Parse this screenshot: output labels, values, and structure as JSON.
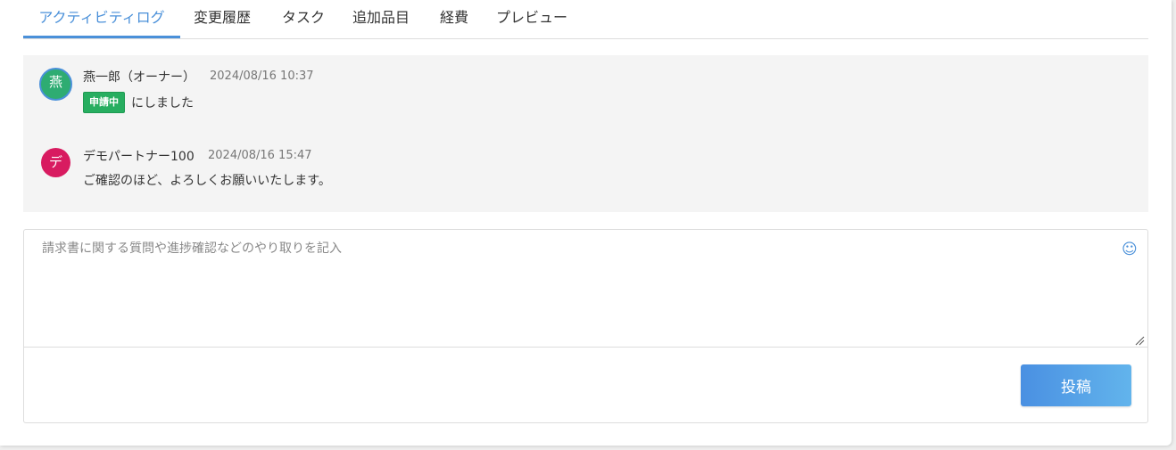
{
  "tabs": [
    {
      "label": "アクティビティログ",
      "active": true
    },
    {
      "label": "変更履歴",
      "active": false
    },
    {
      "label": "タスク",
      "active": false
    },
    {
      "label": "追加品目",
      "active": false
    },
    {
      "label": "経費",
      "active": false
    },
    {
      "label": "プレビュー",
      "active": false
    }
  ],
  "activity": [
    {
      "avatar_text": "燕",
      "avatar_color": "#2eac72",
      "author": "燕一郎（オーナー）",
      "timestamp": "2024/08/16 10:37",
      "badge": "申請中",
      "message": "にしました"
    },
    {
      "avatar_text": "デ",
      "avatar_color": "#d81b60",
      "author": "デモパートナー100",
      "timestamp": "2024/08/16 15:47",
      "message": "ご確認のほど、よろしくお願いいたします。"
    }
  ],
  "composer": {
    "placeholder": "請求書に関する質問や進捗確認などのやり取りを記入",
    "value": "",
    "emoji_icon": "smiley-icon",
    "post_label": "投稿"
  },
  "colors": {
    "accent": "#4a90d9",
    "status_badge": "#27ae60"
  }
}
